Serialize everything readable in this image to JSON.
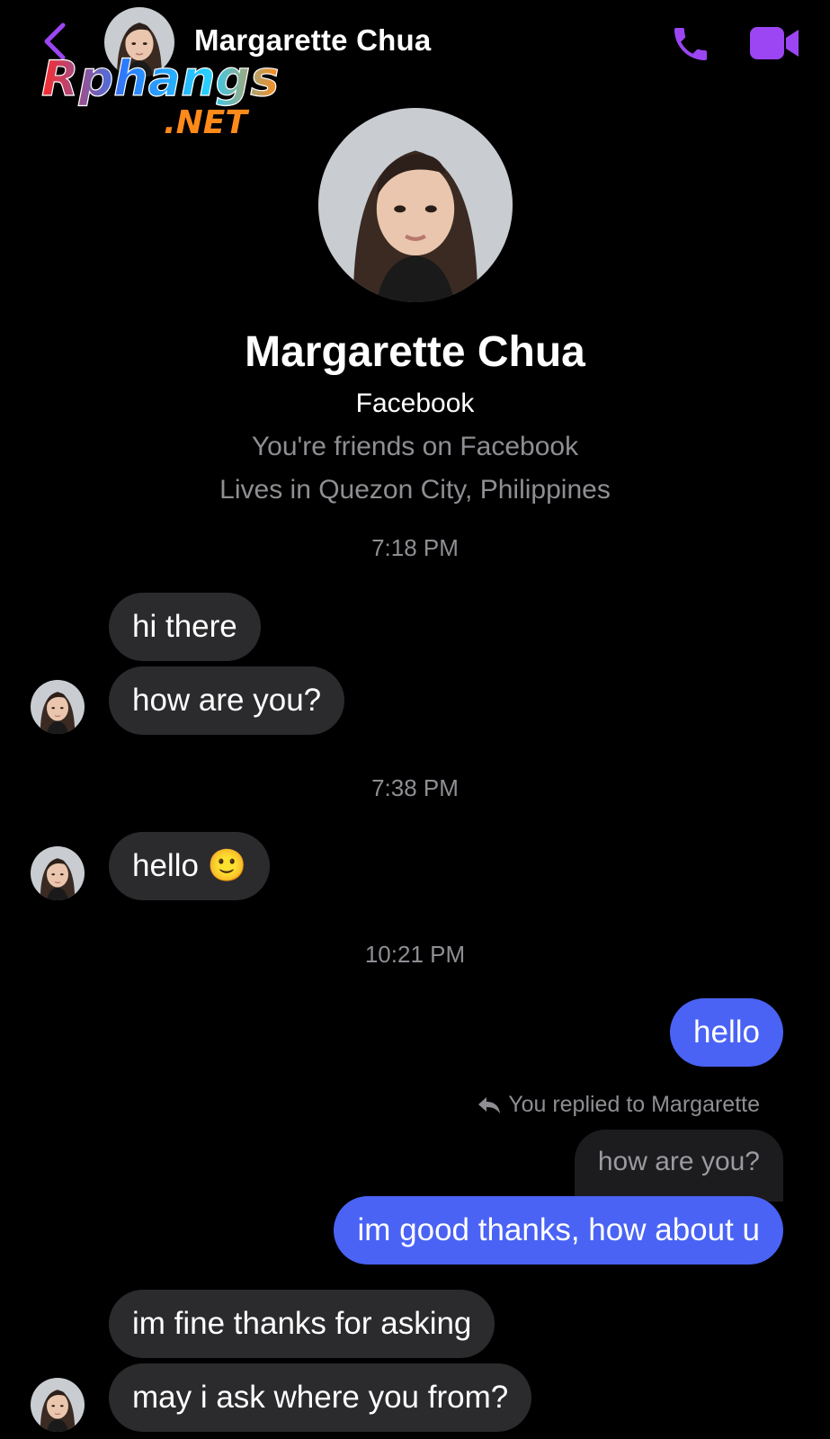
{
  "header": {
    "back_icon": "chevron-left-icon",
    "contact_name": "Margarette Chua",
    "call_icon": "phone-icon",
    "video_icon": "video-camera-icon",
    "accent_color": "#9b46f2"
  },
  "watermark": {
    "brand": "Rphangs",
    "tld": ".NET"
  },
  "profile": {
    "name": "Margarette Chua",
    "platform": "Facebook",
    "friend_status": "You're friends on Facebook",
    "location": "Lives in Quezon City, Philippines"
  },
  "conversation": {
    "groups": [
      {
        "time": "7:18 PM",
        "messages": [
          {
            "from": "contact",
            "text": "hi there"
          },
          {
            "from": "contact",
            "text": "how are you?"
          }
        ]
      },
      {
        "time": "7:38 PM",
        "messages": [
          {
            "from": "contact",
            "text": "hello 🙂"
          }
        ]
      },
      {
        "time": "10:21 PM",
        "messages": [
          {
            "from": "me",
            "text": "hello"
          },
          {
            "from": "me",
            "reply_note": "You replied to Margarette",
            "quoted": "how are you?",
            "text": "im good thanks, how about u"
          },
          {
            "from": "contact",
            "text": "im fine thanks for asking"
          },
          {
            "from": "contact",
            "text": "may i ask where you from?"
          }
        ]
      }
    ]
  },
  "colors": {
    "incoming_bubble": "#2b2b2d",
    "outgoing_bubble": "#4a63f5",
    "muted_text": "#8e8e93"
  }
}
